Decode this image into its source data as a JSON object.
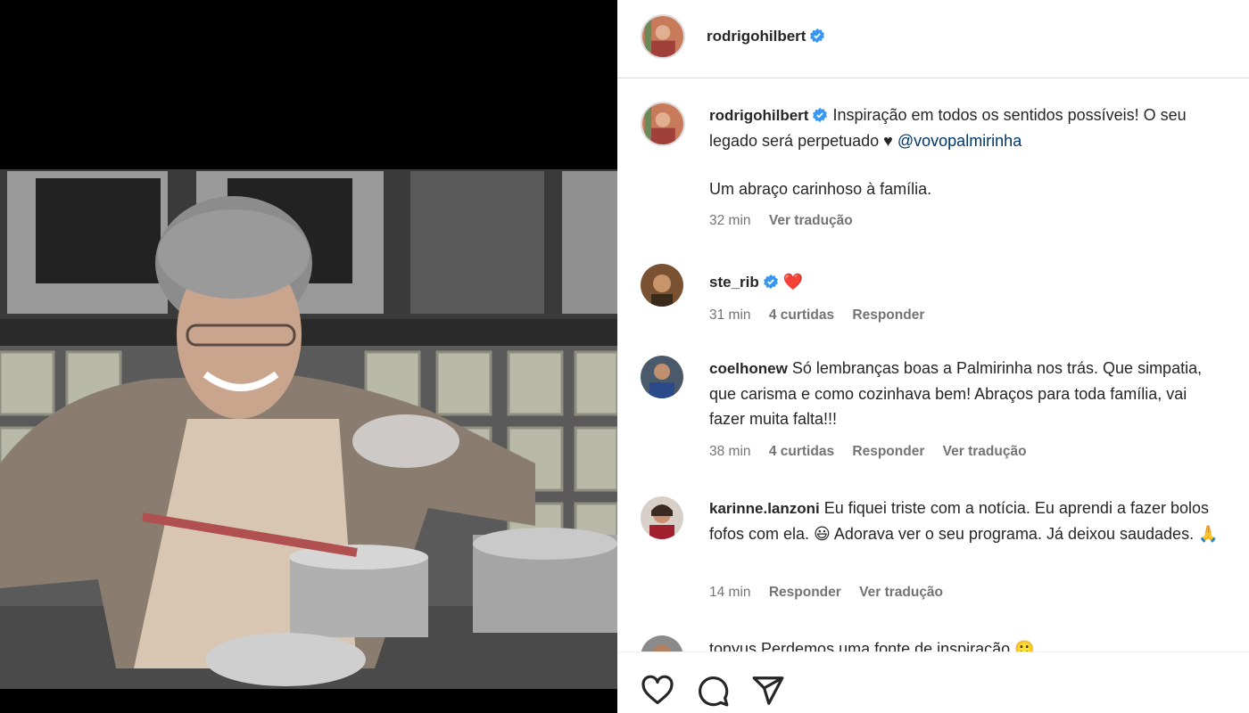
{
  "post": {
    "author": "rodrigohilbert",
    "caption_text": "Inspiração em todos os sentidos possíveis! O seu legado será perpetuado",
    "heart_glyph": "♥",
    "mention": "@vovopalmirinha",
    "caption_line2": "Um abraço carinhoso à família.",
    "time": "32 min",
    "translate": "Ver tradução"
  },
  "comments": [
    {
      "user": "ste_rib",
      "verified": true,
      "text": "❤️",
      "time": "31 min",
      "likes": "4 curtidas",
      "reply": "Responder"
    },
    {
      "user": "coelhonew",
      "verified": false,
      "text": "Só lembranças boas a Palmirinha nos trás. Que simpatia, que carisma e como cozinhava bem! Abraços para toda família, vai fazer muita falta!!!",
      "time": "38 min",
      "likes": "4 curtidas",
      "reply": "Responder",
      "translate": "Ver tradução"
    },
    {
      "user": "karinne.lanzoni",
      "verified": false,
      "text": "Eu fiquei triste com a notícia. Eu aprendi a fazer bolos fofos com ela. 😃 Adorava ver o seu programa. Já deixou saudades. 🙏",
      "time": "14 min",
      "reply": "Responder",
      "translate": "Ver tradução"
    }
  ],
  "partial_comment": {
    "text": "tonyus Perdemos uma fonte de inspiração 🙂"
  },
  "icons": {
    "verified_color": "#3897f0",
    "like": "heart-icon",
    "comment": "comment-icon",
    "share": "share-icon"
  }
}
